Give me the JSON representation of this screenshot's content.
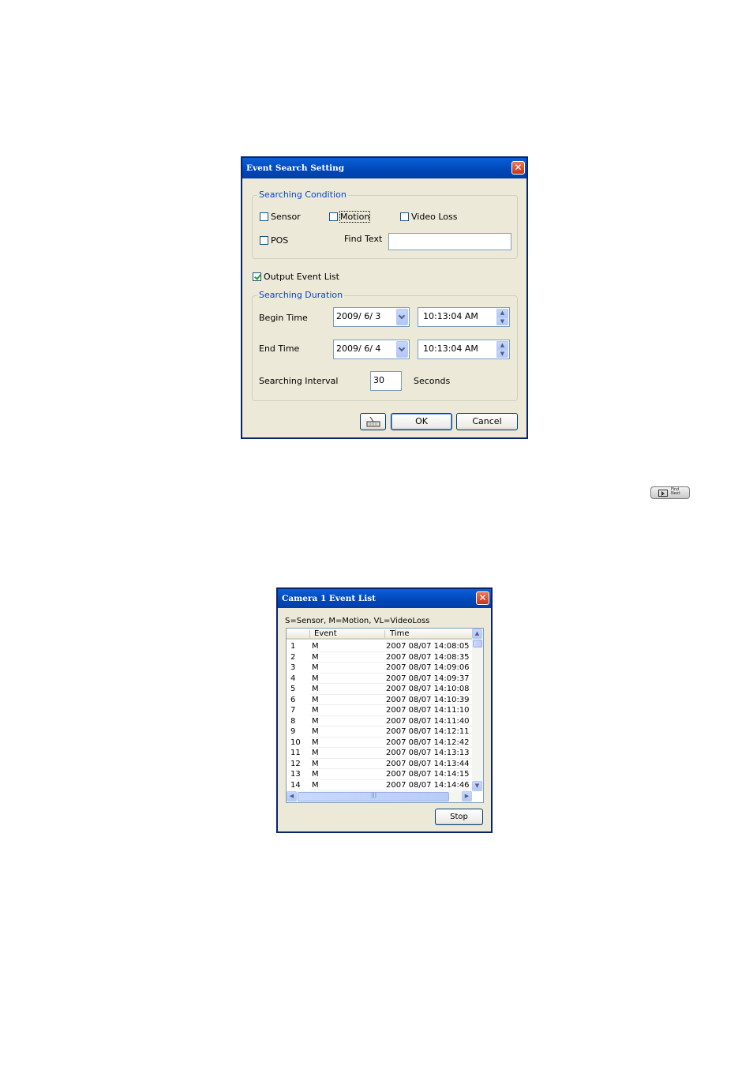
{
  "event_search": {
    "title": "Event Search Setting",
    "close_label": "✕",
    "searching_condition": {
      "legend": "Searching Condition",
      "sensor_label": "Sensor",
      "motion_label": "Motion",
      "video_loss_label": "Video Loss",
      "pos_label": "POS",
      "find_text_label": "Find Text",
      "find_text_value": ""
    },
    "output_event_list_label": "Output Event List",
    "searching_duration": {
      "legend": "Searching Duration",
      "begin_time_label": "Begin Time",
      "begin_date": "2009/ 6/ 3",
      "begin_time": "10:13:04  AM",
      "end_time_label": "End Time",
      "end_date": "2009/ 6/ 4",
      "end_time": "10:13:04  AM",
      "interval_label": "Searching Interval",
      "interval_value": "30",
      "seconds_label": "Seconds"
    },
    "ok_label": "OK",
    "cancel_label": "Cancel"
  },
  "event_list": {
    "title": "Camera 1  Event List",
    "close_label": "✕",
    "legend_text": "S=Sensor, M=Motion, VL=VideoLoss",
    "columns": [
      "",
      "Event",
      "Time"
    ],
    "rows": [
      [
        "1",
        "M",
        "2007 08/07 14:08:05"
      ],
      [
        "2",
        "M",
        "2007 08/07 14:08:35"
      ],
      [
        "3",
        "M",
        "2007 08/07 14:09:06"
      ],
      [
        "4",
        "M",
        "2007 08/07 14:09:37"
      ],
      [
        "5",
        "M",
        "2007 08/07 14:10:08"
      ],
      [
        "6",
        "M",
        "2007 08/07 14:10:39"
      ],
      [
        "7",
        "M",
        "2007 08/07 14:11:10"
      ],
      [
        "8",
        "M",
        "2007 08/07 14:11:40"
      ],
      [
        "9",
        "M",
        "2007 08/07 14:12:11"
      ],
      [
        "10",
        "M",
        "2007 08/07 14:12:42"
      ],
      [
        "11",
        "M",
        "2007 08/07 14:13:13"
      ],
      [
        "12",
        "M",
        "2007 08/07 14:13:44"
      ],
      [
        "13",
        "M",
        "2007 08/07 14:14:15"
      ],
      [
        "14",
        "M",
        "2007 08/07 14:14:46"
      ]
    ],
    "stop_label": "Stop"
  },
  "find_next_button": {
    "label": "Find Next"
  }
}
